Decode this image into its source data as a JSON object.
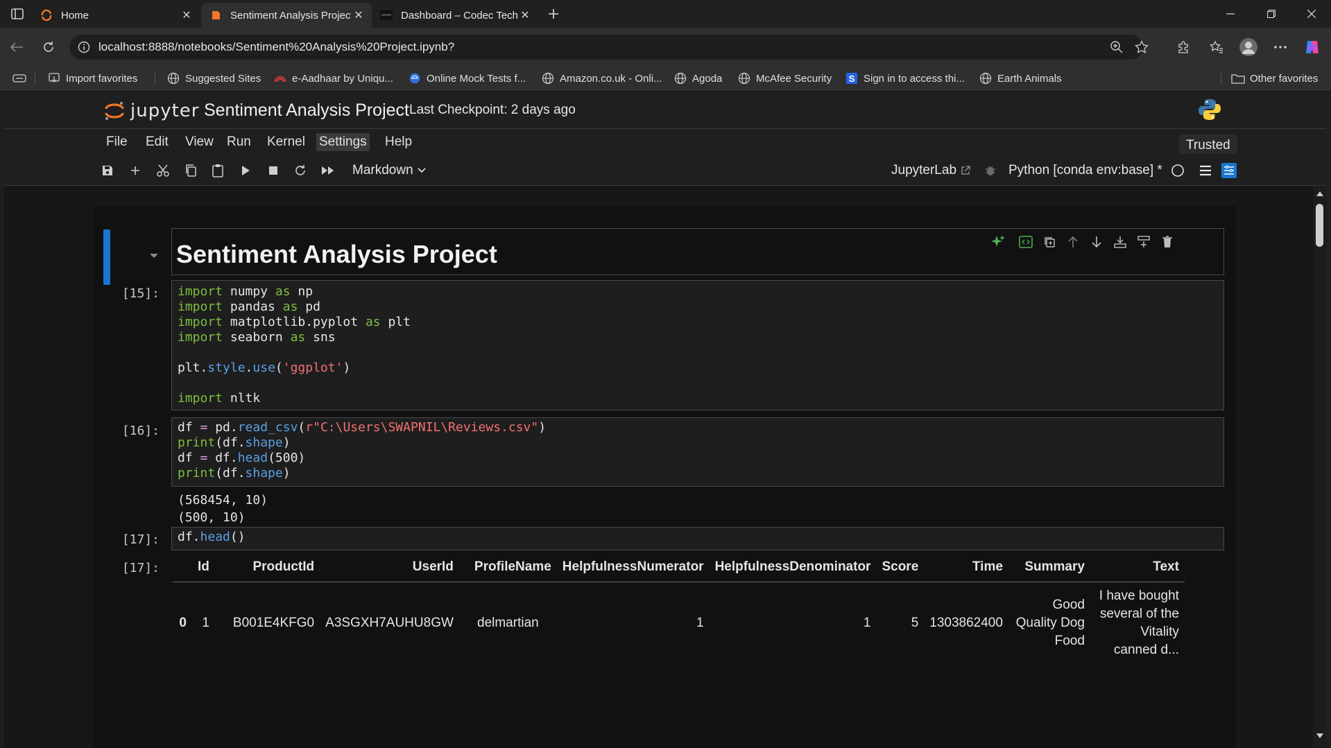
{
  "browser": {
    "tabs": [
      {
        "title": "Home",
        "active": false
      },
      {
        "title": "Sentiment Analysis Project",
        "active": true
      },
      {
        "title": "Dashboard – Codec Technologies",
        "active": false
      }
    ],
    "url": "localhost:8888/notebooks/Sentiment%20Analysis%20Project.ipynb?",
    "bookmarks": [
      {
        "label": "Import favorites",
        "icon": "import-icon"
      },
      {
        "label": "Suggested Sites",
        "icon": "globe-icon"
      },
      {
        "label": "e-Aadhaar by Uniqu...",
        "icon": "aadhaar-icon"
      },
      {
        "label": "Online Mock Tests f...",
        "icon": "edge-icon"
      },
      {
        "label": "Amazon.co.uk - Onli...",
        "icon": "globe-icon"
      },
      {
        "label": "Agoda",
        "icon": "globe-icon"
      },
      {
        "label": "McAfee Security",
        "icon": "globe-icon"
      },
      {
        "label": "Sign in to access thi...",
        "icon": "s-icon"
      },
      {
        "label": "Earth Animals",
        "icon": "globe-icon"
      }
    ],
    "other_favorites": "Other favorites"
  },
  "jupyter": {
    "logo_text": "jupyter",
    "notebook_title": "Sentiment Analysis Project",
    "checkpoint": "Last Checkpoint: 2 days ago",
    "menu": [
      "File",
      "Edit",
      "View",
      "Run",
      "Kernel",
      "Settings",
      "Help"
    ],
    "trusted": "Trusted",
    "cell_type": "Markdown",
    "jupyterlab_link": "JupyterLab",
    "kernel_name": "Python [conda env:base] *",
    "colors": {
      "accent": "#1976d2",
      "keyword": "#7fbf3f",
      "function": "#5aa0e6",
      "string": "#f07070",
      "logo_orange": "#f37726"
    }
  },
  "cells": {
    "markdown_heading": "Sentiment Analysis Project",
    "c15": {
      "prompt": "[15]:",
      "lines": [
        [
          [
            "kw",
            "import"
          ],
          [
            "t",
            " numpy "
          ],
          [
            "kw",
            "as"
          ],
          [
            "t",
            " np"
          ]
        ],
        [
          [
            "kw",
            "import"
          ],
          [
            "t",
            " pandas "
          ],
          [
            "kw",
            "as"
          ],
          [
            "t",
            " pd"
          ]
        ],
        [
          [
            "kw",
            "import"
          ],
          [
            "t",
            " matplotlib.pyplot "
          ],
          [
            "kw",
            "as"
          ],
          [
            "t",
            " plt"
          ]
        ],
        [
          [
            "kw",
            "import"
          ],
          [
            "t",
            " seaborn "
          ],
          [
            "kw",
            "as"
          ],
          [
            "t",
            " sns"
          ]
        ],
        [],
        [
          [
            "t",
            "plt."
          ],
          [
            "fn",
            "style"
          ],
          [
            "t",
            "."
          ],
          [
            "fn",
            "use"
          ],
          [
            "t",
            "("
          ],
          [
            "str",
            "'ggplot'"
          ],
          [
            "t",
            ")"
          ]
        ],
        [],
        [
          [
            "kw",
            "import"
          ],
          [
            "t",
            " nltk"
          ]
        ]
      ]
    },
    "c16": {
      "prompt": "[16]:",
      "lines": [
        [
          [
            "t",
            "df "
          ],
          [
            "op",
            "="
          ],
          [
            "t",
            " pd."
          ],
          [
            "fn",
            "read_csv"
          ],
          [
            "t",
            "("
          ],
          [
            "str",
            "r\"C:\\Users\\SWAPNIL\\Reviews.csv\""
          ],
          [
            "t",
            ")"
          ]
        ],
        [
          [
            "kw",
            "print"
          ],
          [
            "t",
            "(df."
          ],
          [
            "fn",
            "shape"
          ],
          [
            "t",
            ")"
          ]
        ],
        [
          [
            "t",
            "df "
          ],
          [
            "op",
            "="
          ],
          [
            "t",
            " df."
          ],
          [
            "fn",
            "head"
          ],
          [
            "t",
            "(500)"
          ]
        ],
        [
          [
            "kw",
            "print"
          ],
          [
            "t",
            "(df."
          ],
          [
            "fn",
            "shape"
          ],
          [
            "t",
            ")"
          ]
        ]
      ],
      "output": [
        "(568454, 10)",
        "(500, 10)"
      ]
    },
    "c17": {
      "prompt": "[17]:",
      "lines": [
        [
          [
            "t",
            "df."
          ],
          [
            "fn",
            "head"
          ],
          [
            "t",
            "()"
          ]
        ]
      ],
      "out_prompt": "[17]:",
      "table": {
        "columns": [
          "",
          "Id",
          "ProductId",
          "UserId",
          "ProfileName",
          "HelpfulnessNumerator",
          "HelpfulnessDenominator",
          "Score",
          "Time",
          "Summary",
          "Text"
        ],
        "rows": [
          [
            "0",
            "1",
            "B001E4KFG0",
            "A3SGXH7AUHU8GW",
            "delmartian",
            "1",
            "1",
            "5",
            "1303862400",
            "Good Quality Dog Food",
            "I have bought several of the Vitality canned d..."
          ]
        ]
      }
    }
  }
}
